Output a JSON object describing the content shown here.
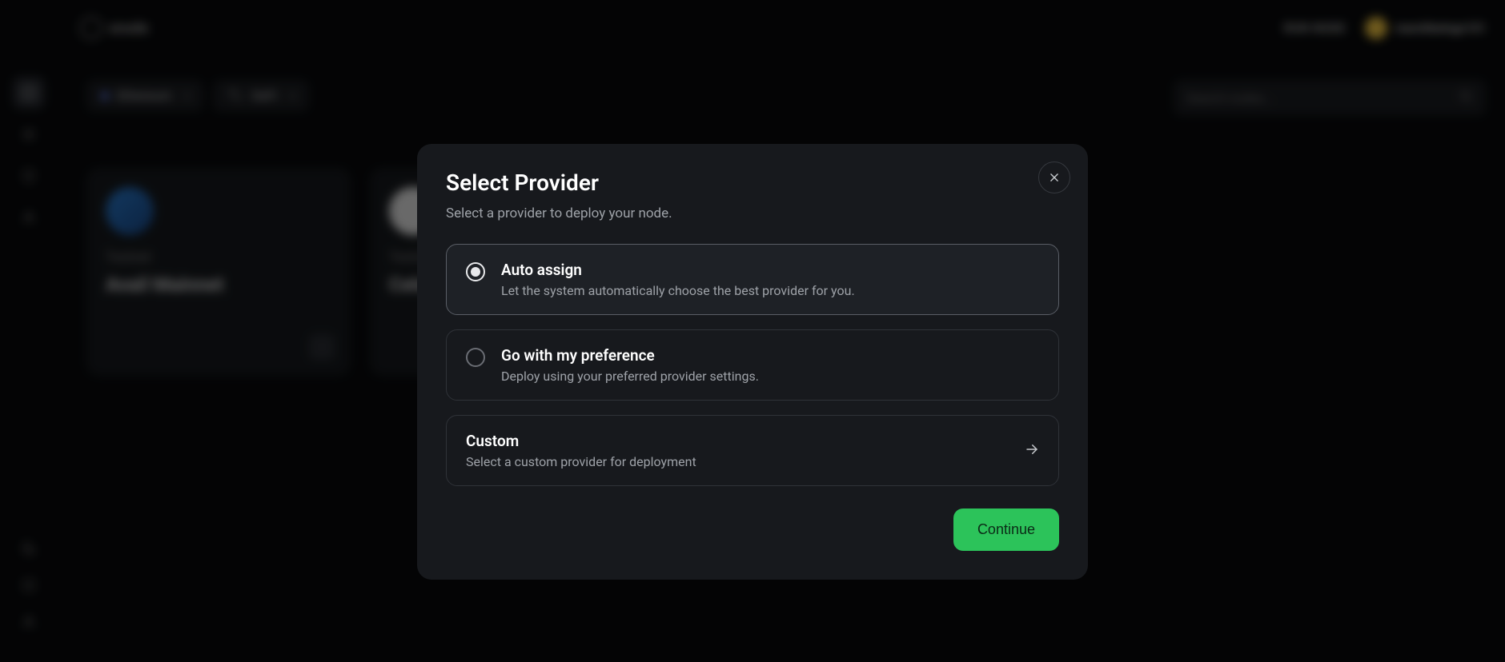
{
  "header": {
    "brand": "xnode",
    "run_node": "RUN NODE",
    "username": "marshbeingx101"
  },
  "filters": {
    "chain": "Ethereum",
    "category": "DeFi"
  },
  "search": {
    "placeholder": "Search nodes..."
  },
  "cards": [
    {
      "badge": "Testnet",
      "title": "Avail Mainnet"
    },
    {
      "badge": "Testnet",
      "title": "Celestia"
    }
  ],
  "modal": {
    "title": "Select Provider",
    "subtitle": "Select a provider to deploy your node.",
    "option_auto": {
      "title": "Auto assign",
      "desc": "Let the system automatically choose the best provider for you."
    },
    "option_pref": {
      "title": "Go with my preference",
      "desc": "Deploy using your preferred provider settings."
    },
    "option_custom": {
      "title": "Custom",
      "desc": "Select a custom provider for deployment"
    },
    "continue": "Continue"
  }
}
